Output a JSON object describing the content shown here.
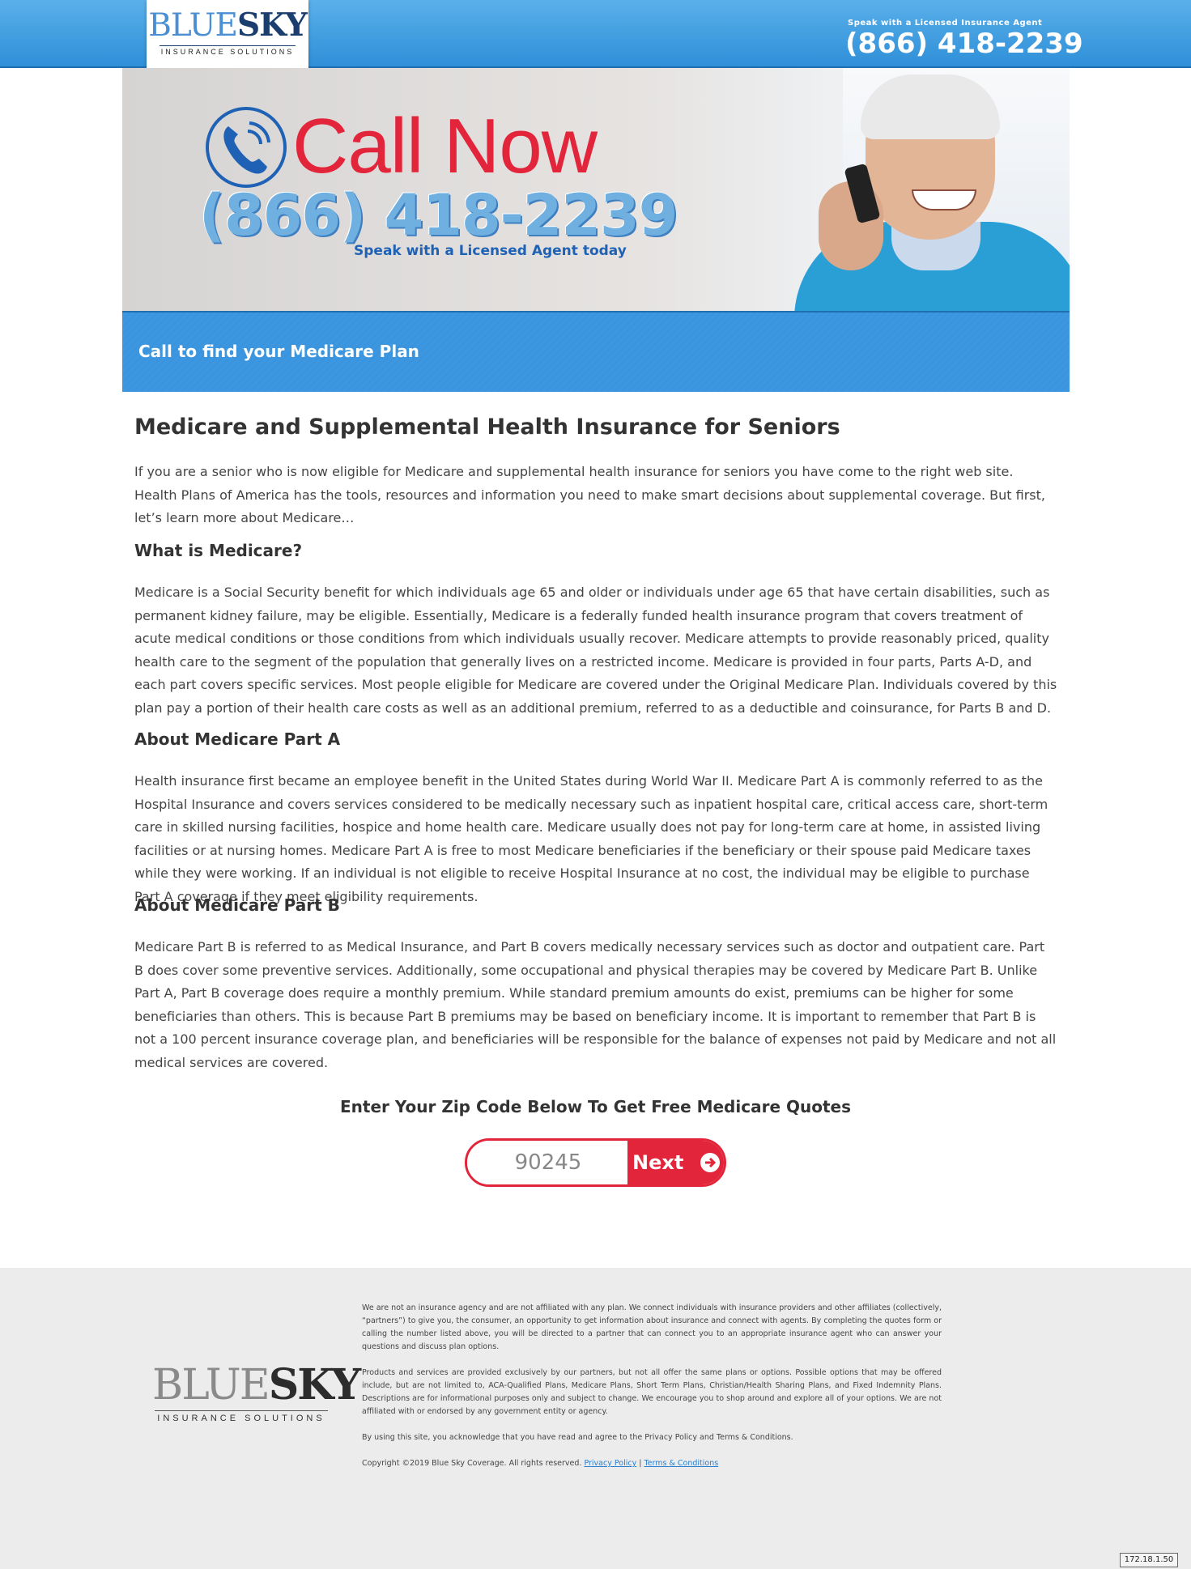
{
  "header": {
    "logo": {
      "blue": "BLUE",
      "sky": "SKY",
      "sub": "INSURANCE SOLUTIONS"
    },
    "phone_label": "Speak with a Licensed Insurance Agent",
    "phone": "(866) 418-2239"
  },
  "hero": {
    "call_now": "Call Now",
    "phone": "(866) 418-2239",
    "sub": "Speak with a Licensed Agent today",
    "band_text": "Call to find your Medicare Plan"
  },
  "article": {
    "title": "Medicare and Supplemental Health Insurance for Seniors",
    "intro": "If you are a senior who is now eligible for Medicare and supplemental health insurance for seniors you have come to the right web site. Health Plans of America has the tools, resources and information you need to make smart decisions about supplemental coverage. But first, let’s learn more about Medicare…",
    "sections": [
      {
        "heading": "What is Medicare?",
        "body": "Medicare is a Social Security benefit for which individuals age 65 and older or individuals under age 65 that have certain disabilities, such as permanent kidney failure, may be eligible. Essentially, Medicare is a federally funded health insurance program that covers treatment of acute medical conditions or those conditions from which individuals usually recover. Medicare attempts to provide reasonably priced, quality health care to the segment of the population that generally lives on a restricted income. Medicare is provided in four parts, Parts A-D, and each part covers specific services. Most people eligible for Medicare are covered under the Original Medicare Plan. Individuals covered by this plan pay a portion of their health care costs as well as an additional premium, referred to as a deductible and coinsurance, for Parts B and D."
      },
      {
        "heading": "About Medicare Part A",
        "body": "Health insurance first became an employee benefit in the United States during World War II. Medicare Part A is commonly referred to as the Hospital Insurance and covers services considered to be medically necessary such as inpatient hospital care, critical access care, short-term care in skilled nursing facilities, hospice and home health care. Medicare usually does not pay for long-term care at home, in assisted living facilities or at nursing homes. Medicare Part A is free to most Medicare beneficiaries if the beneficiary or their spouse paid Medicare taxes while they were working. If an individual is not eligible to receive Hospital Insurance at no cost, the individual may be eligible to purchase Part A coverage if they meet eligibility requirements."
      },
      {
        "heading": "About Medicare Part B",
        "body": "Medicare Part B is referred to as Medical Insurance, and Part B covers medically necessary services such as doctor and outpatient care. Part B does cover some preventive services. Additionally, some occupational and physical therapies may be covered by Medicare Part B. Unlike Part A, Part B coverage does require a monthly premium. While standard premium amounts do exist, premiums can be higher for some beneficiaries than others. This is because Part B premiums may be based on beneficiary income. It is important to remember that Part B is not a 100 percent insurance coverage plan, and beneficiaries will be responsible for the balance of expenses not paid by Medicare and not all medical services are covered."
      }
    ]
  },
  "zip": {
    "heading": "Enter Your Zip Code Below To Get Free Medicare Quotes",
    "placeholder": "90245",
    "button": "Next"
  },
  "footer": {
    "logo": {
      "blue": "BLUE",
      "sky": "SKY",
      "sub": "INSURANCE SOLUTIONS"
    },
    "para1": "We are not an insurance agency and are not affiliated with any plan. We connect individuals with insurance providers and other affiliates (collectively, “partners”) to give you, the consumer, an opportunity to get information about insurance and connect with agents. By completing the quotes form or calling the number listed above, you will be directed to a partner that can connect you to an appropriate insurance agent who can answer your questions and discuss plan options.",
    "para2": "Products and services are provided exclusively by our partners, but not all offer the same plans or options. Possible options that may be offered include, but are not limited to, ACA-Qualified Plans, Medicare Plans, Short Term Plans, Christian/Health Sharing Plans, and Fixed Indemnity Plans. Descriptions are for informational purposes only and subject to change. We encourage you to shop around and explore all of your options. We are not affiliated with or endorsed by any government entity or agency.",
    "para3": "By using this site, you acknowledge that you have read and agree to the Privacy Policy and Terms & Conditions.",
    "copyright": "Copyright ©2019 Blue Sky Coverage. All rights reserved.",
    "privacy_link": "Privacy Policy",
    "separator": "|",
    "terms_link": "Terms & Conditions"
  },
  "ip_badge": "172.18.1.50",
  "colors": {
    "brand_blue": "#2f8fd8",
    "accent_red": "#e2253a",
    "dark_blue": "#1f62b5"
  }
}
